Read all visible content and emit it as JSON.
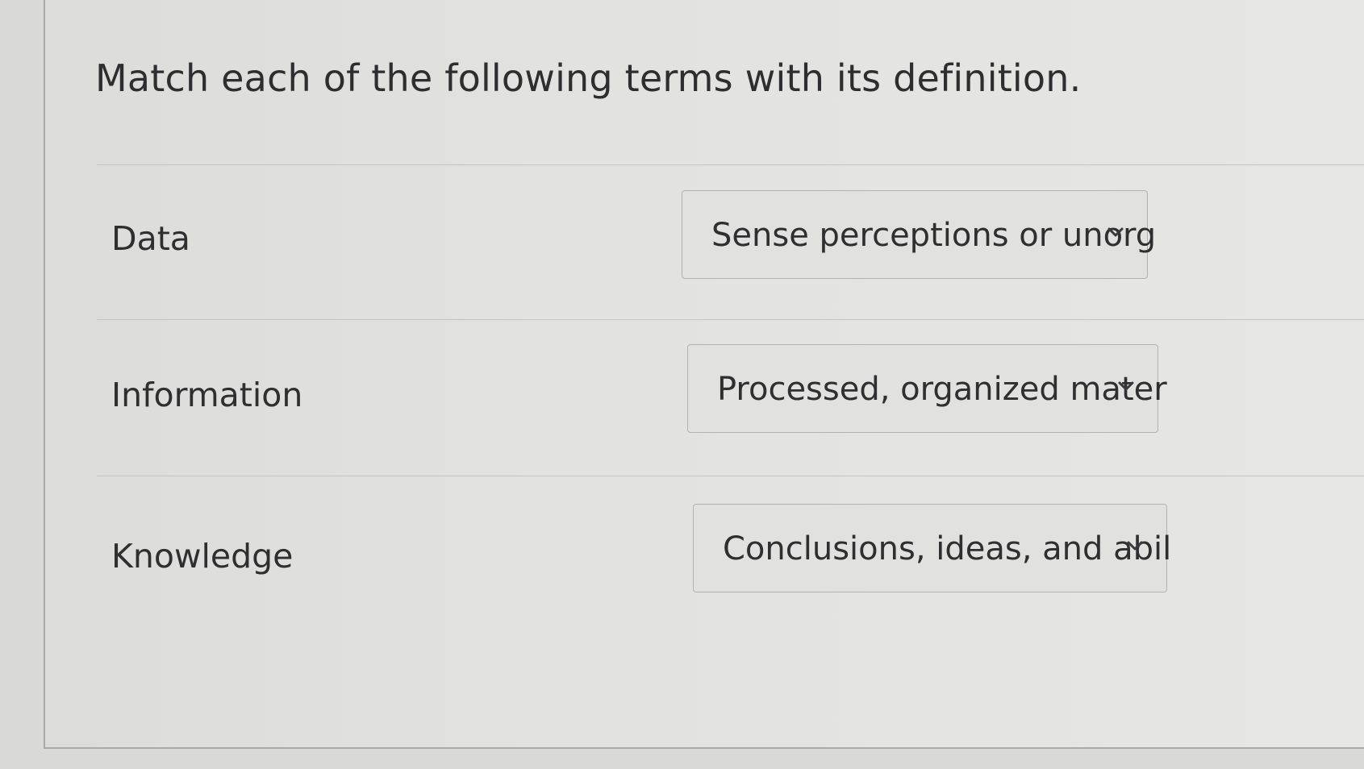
{
  "question": "Match each of the following terms with its definition.",
  "rows": [
    {
      "term": "Data",
      "selected": "Sense perceptions or unorg"
    },
    {
      "term": "Information",
      "selected": "Processed, organized mater"
    },
    {
      "term": "Knowledge",
      "selected": "Conclusions, ideas, and abil"
    }
  ],
  "icons": {
    "dropdown": "chevron-down-icon"
  },
  "colors": {
    "text": "#2f2f31",
    "border": "#b2b2b0",
    "background": "#e2e2e0"
  }
}
